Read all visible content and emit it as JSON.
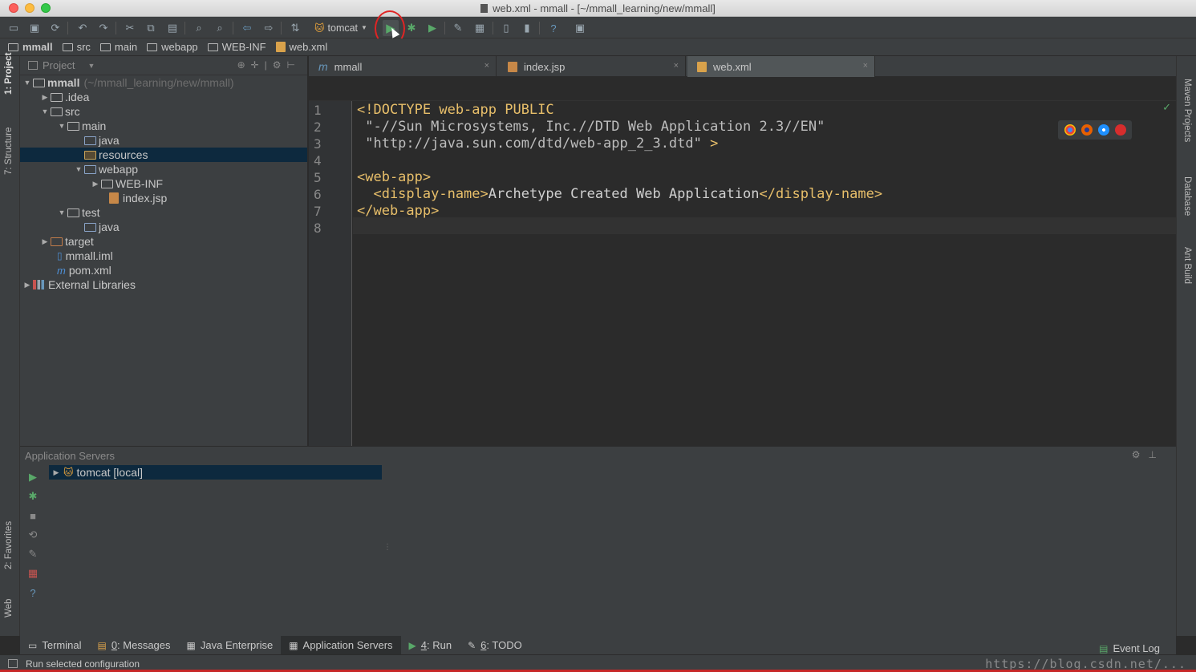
{
  "window": {
    "title": "web.xml - mmall - [~/mmall_learning/new/mmall]"
  },
  "toolbar": {
    "run_config": "tomcat"
  },
  "breadcrumbs": [
    "mmall",
    "src",
    "main",
    "webapp",
    "WEB-INF",
    "web.xml"
  ],
  "left_strip": {
    "project": "1: Project",
    "structure": "7: Structure",
    "favorites": "2: Favorites",
    "web": "Web"
  },
  "right_strip": {
    "maven": "Maven Projects",
    "database": "Database",
    "ant": "Ant Build"
  },
  "project_panel": {
    "header": "Project",
    "tree": [
      {
        "label": "mmall",
        "extra": "(~/mmall_learning/new/mmall)"
      },
      {
        "label": ".idea"
      },
      {
        "label": "src"
      },
      {
        "label": "main"
      },
      {
        "label": "java"
      },
      {
        "label": "resources"
      },
      {
        "label": "webapp"
      },
      {
        "label": "WEB-INF"
      },
      {
        "label": "index.jsp"
      },
      {
        "label": "test"
      },
      {
        "label": "java"
      },
      {
        "label": "target"
      },
      {
        "label": "mmall.iml"
      },
      {
        "label": "pom.xml"
      },
      {
        "label": "External Libraries"
      }
    ]
  },
  "editor_tabs": [
    "mmall",
    "index.jsp",
    "web.xml"
  ],
  "editor": {
    "line_numbers": [
      "1",
      "2",
      "3",
      "4",
      "5",
      "6",
      "7",
      "8"
    ],
    "lines": {
      "l1": "<!DOCTYPE web-app PUBLIC",
      "l2": " \"-//Sun Microsystems, Inc.//DTD Web Application 2.3//EN\"",
      "l3a": " \"http://java.sun.com/dtd/web-app_2_3.dtd\"",
      "l3b": " >",
      "l5": "<web-app>",
      "l6a": "  <display-name>",
      "l6b": "Archetype Created Web Application",
      "l6c": "</display-name>",
      "l7": "</web-app>"
    }
  },
  "app_servers": {
    "title": "Application Servers",
    "server": "tomcat [local]"
  },
  "bottom_tabs": {
    "terminal": "Terminal",
    "messages_num": "0",
    "messages": ": Messages",
    "java_enterprise": "Java Enterprise",
    "app_servers": "Application Servers",
    "run_num": "4",
    "run": ": Run",
    "todo_num": "6",
    "todo": ": TODO",
    "event_log": "Event Log"
  },
  "status": {
    "text": "Run selected configuration",
    "watermark": "https://blog.csdn.net/..."
  },
  "colors": {
    "accent_green": "#59a869",
    "highlight_ring": "#e02424",
    "selection": "#0d293e"
  }
}
